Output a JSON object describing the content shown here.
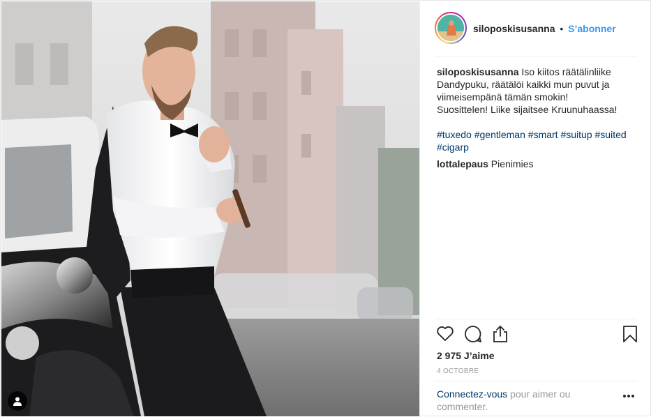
{
  "post": {
    "username": "siloposkisusanna",
    "separator": "•",
    "follow_label": "S’abonner",
    "caption": {
      "username": "siloposkisusanna",
      "lines": [
        "Iso kiitos räätälinliike",
        "Dandypuku, räätälöi kaikki mun puvut ja",
        "viimeisempänä tämän smokin!",
        "Suosittelen! Liike sijaitsee Kruunuhaassa!"
      ],
      "hashtags": [
        "#tuxedo",
        "#gentleman",
        "#smart",
        "#suitup",
        "#suited",
        "#cigarp"
      ]
    },
    "comment": {
      "username": "lottalepaus",
      "text": "Pienimies"
    },
    "likes": "2 975 J’aime",
    "date": "4 OCTOBRE",
    "login_prompt": {
      "link": "Connectez-vous",
      "text": " pour aimer ou commenter."
    }
  },
  "icons": {
    "like": "heart-icon",
    "comment": "comment-icon",
    "share": "share-icon",
    "save": "bookmark-icon",
    "more": "more-options-icon",
    "tag": "user-tag-icon"
  },
  "colors": {
    "link_blue": "#3897f0",
    "hashtag_blue": "#003569",
    "text": "#262626",
    "muted": "#999999",
    "border": "#efefef"
  }
}
